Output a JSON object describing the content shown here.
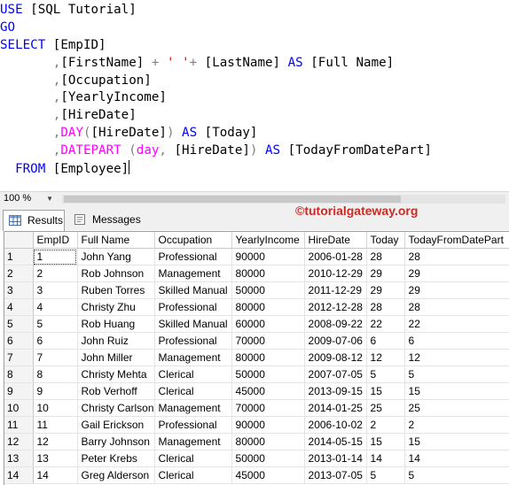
{
  "editor": {
    "lines": [
      [
        {
          "t": "USE",
          "c": "kw"
        },
        {
          "t": " [SQL Tutorial]",
          "c": ""
        }
      ],
      [
        {
          "t": "GO",
          "c": "kw"
        }
      ],
      [
        {
          "t": "SELECT",
          "c": "kw"
        },
        {
          "t": " [EmpID]",
          "c": ""
        }
      ],
      [
        {
          "t": "       ",
          "c": ""
        },
        {
          "t": ",",
          "c": "op"
        },
        {
          "t": "[FirstName] ",
          "c": ""
        },
        {
          "t": "+",
          "c": "op"
        },
        {
          "t": " ",
          "c": ""
        },
        {
          "t": "' '",
          "c": "str"
        },
        {
          "t": "+",
          "c": "op"
        },
        {
          "t": " [LastName] ",
          "c": ""
        },
        {
          "t": "AS",
          "c": "kw"
        },
        {
          "t": " [Full Name]",
          "c": ""
        }
      ],
      [
        {
          "t": "       ",
          "c": ""
        },
        {
          "t": ",",
          "c": "op"
        },
        {
          "t": "[Occupation]",
          "c": ""
        }
      ],
      [
        {
          "t": "       ",
          "c": ""
        },
        {
          "t": ",",
          "c": "op"
        },
        {
          "t": "[YearlyIncome]",
          "c": ""
        }
      ],
      [
        {
          "t": "       ",
          "c": ""
        },
        {
          "t": ",",
          "c": "op"
        },
        {
          "t": "[HireDate]",
          "c": ""
        }
      ],
      [
        {
          "t": "       ",
          "c": ""
        },
        {
          "t": ",",
          "c": "op"
        },
        {
          "t": "DAY",
          "c": "fn"
        },
        {
          "t": "(",
          "c": "op"
        },
        {
          "t": "[HireDate]",
          "c": ""
        },
        {
          "t": ")",
          "c": "op"
        },
        {
          "t": " ",
          "c": ""
        },
        {
          "t": "AS",
          "c": "kw"
        },
        {
          "t": " [Today]",
          "c": ""
        }
      ],
      [
        {
          "t": "       ",
          "c": ""
        },
        {
          "t": ",",
          "c": "op"
        },
        {
          "t": "DATEPART",
          "c": "fn"
        },
        {
          "t": " ",
          "c": ""
        },
        {
          "t": "(",
          "c": "op"
        },
        {
          "t": "day",
          "c": "fn"
        },
        {
          "t": ",",
          "c": "op"
        },
        {
          "t": " [HireDate]",
          "c": ""
        },
        {
          "t": ")",
          "c": "op"
        },
        {
          "t": " ",
          "c": ""
        },
        {
          "t": "AS",
          "c": "kw"
        },
        {
          "t": " [TodayFromDatePart]",
          "c": ""
        }
      ],
      [
        {
          "t": "  ",
          "c": ""
        },
        {
          "t": "FROM",
          "c": "kw"
        },
        {
          "t": " [Employee]",
          "c": ""
        }
      ]
    ]
  },
  "zoom": {
    "value": "100 %"
  },
  "tabs": {
    "results": "Results",
    "messages": "Messages"
  },
  "watermark": "©tutorialgateway.org",
  "grid": {
    "columns": [
      "EmpID",
      "Full Name",
      "Occupation",
      "YearlyIncome",
      "HireDate",
      "Today",
      "TodayFromDatePart"
    ],
    "rows": [
      [
        "1",
        "John Yang",
        "Professional",
        "90000",
        "2006-01-28",
        "28",
        "28"
      ],
      [
        "2",
        "Rob Johnson",
        "Management",
        "80000",
        "2010-12-29",
        "29",
        "29"
      ],
      [
        "3",
        "Ruben Torres",
        "Skilled Manual",
        "50000",
        "2011-12-29",
        "29",
        "29"
      ],
      [
        "4",
        "Christy Zhu",
        "Professional",
        "80000",
        "2012-12-28",
        "28",
        "28"
      ],
      [
        "5",
        "Rob Huang",
        "Skilled Manual",
        "60000",
        "2008-09-22",
        "22",
        "22"
      ],
      [
        "6",
        "John Ruiz",
        "Professional",
        "70000",
        "2009-07-06",
        "6",
        "6"
      ],
      [
        "7",
        "John Miller",
        "Management",
        "80000",
        "2009-08-12",
        "12",
        "12"
      ],
      [
        "8",
        "Christy Mehta",
        "Clerical",
        "50000",
        "2007-07-05",
        "5",
        "5"
      ],
      [
        "9",
        "Rob Verhoff",
        "Clerical",
        "45000",
        "2013-09-15",
        "15",
        "15"
      ],
      [
        "10",
        "Christy Carlson",
        "Management",
        "70000",
        "2014-01-25",
        "25",
        "25"
      ],
      [
        "11",
        "Gail Erickson",
        "Professional",
        "90000",
        "2006-10-02",
        "2",
        "2"
      ],
      [
        "12",
        "Barry Johnson",
        "Management",
        "80000",
        "2014-05-15",
        "15",
        "15"
      ],
      [
        "13",
        "Peter Krebs",
        "Clerical",
        "50000",
        "2013-01-14",
        "14",
        "14"
      ],
      [
        "14",
        "Greg Alderson",
        "Clerical",
        "45000",
        "2013-07-05",
        "5",
        "5"
      ]
    ]
  },
  "colors": {
    "keyword": "#0000ff",
    "function": "#ff00ff",
    "string": "#ff0000",
    "operator": "#808080",
    "watermark": "#cc2a22"
  }
}
